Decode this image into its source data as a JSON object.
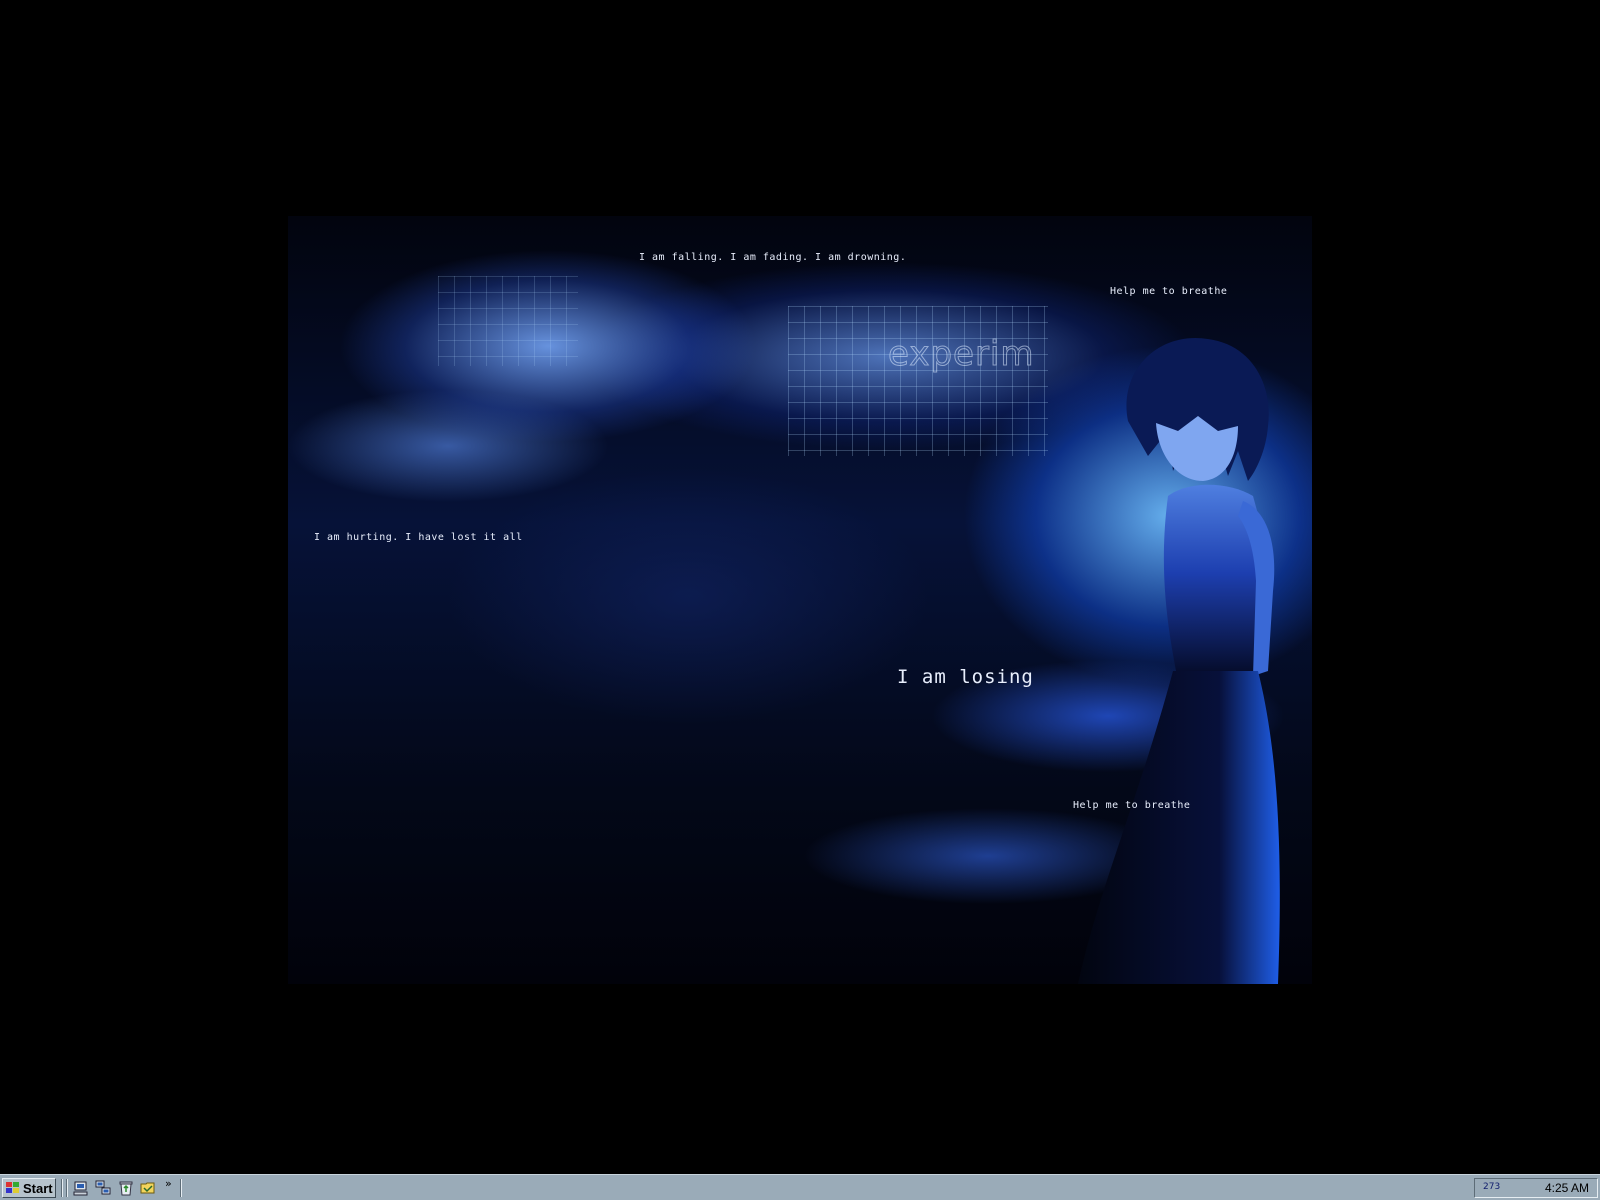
{
  "wallpaper": {
    "watermark_text": "experim",
    "lines": [
      "I am falling. I am fading. I am drowning.",
      "Help me to breathe",
      "I am hurting. I have lost it all",
      "I am losing",
      "Help me to breathe"
    ]
  },
  "taskbar": {
    "start_label": "Start",
    "quick_launch": [
      {
        "icon": "computer-icon"
      },
      {
        "icon": "network-icon"
      },
      {
        "icon": "recycle-bin-icon"
      },
      {
        "icon": "folder-icon"
      }
    ],
    "more_label": "»",
    "tray": {
      "counter": "273",
      "clock": "4:25 AM"
    }
  },
  "colors": {
    "desktop_background": "#000000",
    "taskbar": "#9aabb8",
    "wallpaper_accent": "#3a78e8",
    "wallpaper_text": "#e8eefc"
  }
}
